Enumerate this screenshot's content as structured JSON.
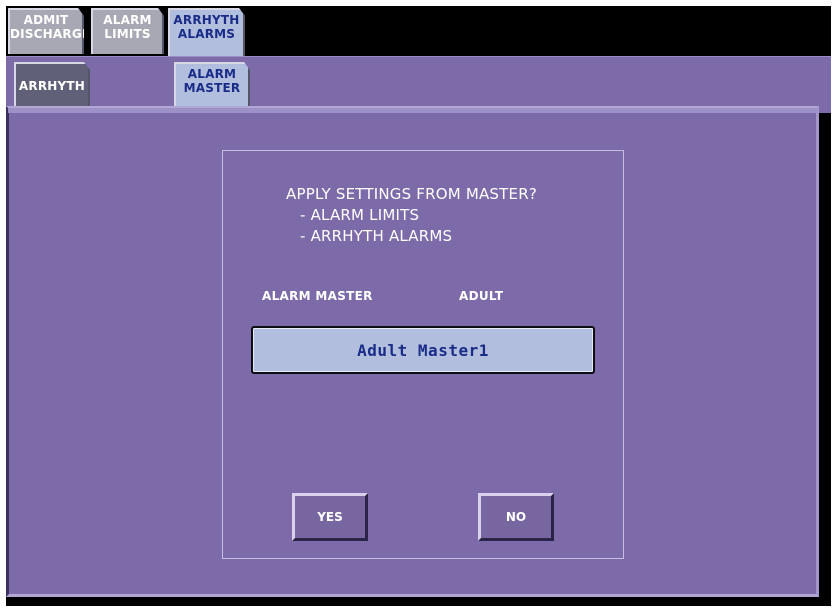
{
  "top_tabs": [
    {
      "line1": "ADMIT",
      "line2": "DISCHARGE",
      "selected": false
    },
    {
      "line1": "ALARM",
      "line2": "LIMITS",
      "selected": false
    },
    {
      "line1": "ARRHYTH",
      "line2": "ALARMS",
      "selected": true
    }
  ],
  "sub_tabs": [
    {
      "line1": "",
      "line2": "ARRHYTH",
      "selected": false
    },
    {
      "line1": "ALARM",
      "line2": "MASTER",
      "selected": true
    }
  ],
  "dialog": {
    "question": "APPLY SETTINGS FROM MASTER?",
    "items": [
      "- ALARM LIMITS",
      "- ARRHYTH ALARMS"
    ],
    "master_label": "ALARM MASTER",
    "patient_type": "ADULT",
    "master_name": "Adult Master1",
    "yes_label": "YES",
    "no_label": "NO"
  },
  "colors": {
    "background": "#7c6ba8",
    "selected_tab": "#b2bedd",
    "unselected_tab": "#a8a8b4",
    "selected_text": "#1a2c88"
  }
}
